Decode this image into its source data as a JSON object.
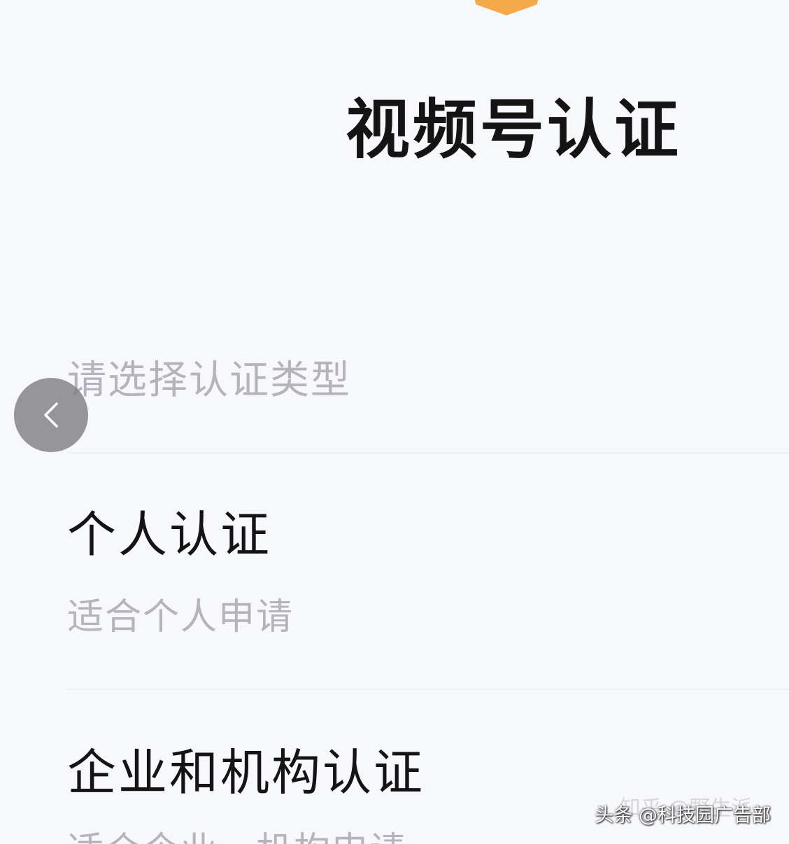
{
  "header": {
    "title": "视频号认证"
  },
  "prompt": "请选择认证类型",
  "options": [
    {
      "title": "个人认证",
      "description": "适合个人申请"
    },
    {
      "title": "企业和机构认证",
      "description": "适合企业、机构申请"
    }
  ],
  "navigation": {
    "back_icon": "chevron-left-icon"
  },
  "watermarks": {
    "faint": "知乎 @野生派",
    "main": "头条 @科技园广告部"
  },
  "colors": {
    "accent": "#f4a94a",
    "title_text": "#141414",
    "secondary_text": "#b7b3bd",
    "background": "#f7f8fc"
  }
}
